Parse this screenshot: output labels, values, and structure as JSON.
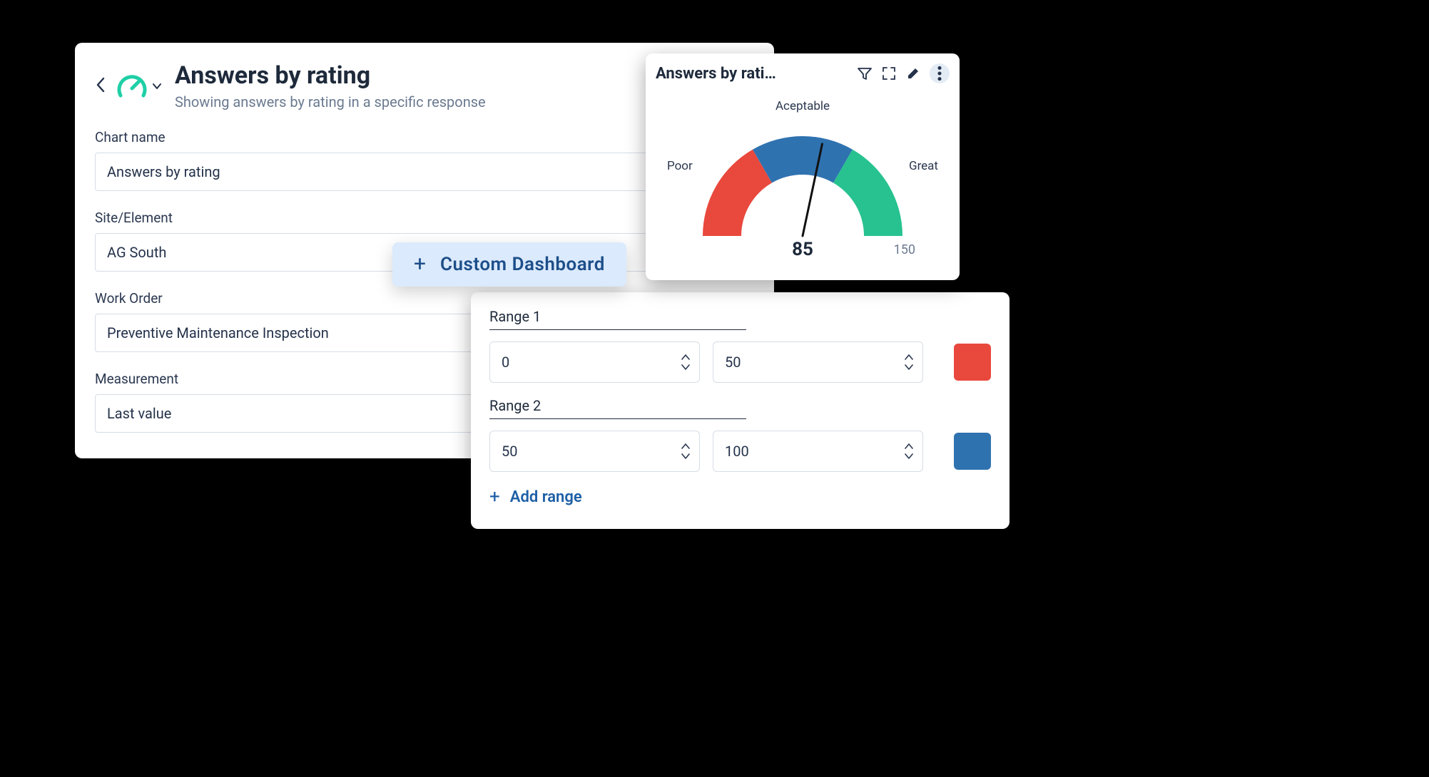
{
  "form": {
    "title": "Answers by rating",
    "subtitle": "Showing answers by rating in a specific response",
    "fields": {
      "chart_name": {
        "label": "Chart name",
        "value": "Answers by rating"
      },
      "site": {
        "label": "Site/Element",
        "value": "AG South"
      },
      "work_order": {
        "label": "Work Order",
        "value": "Preventive Maintenance Inspection"
      },
      "measurement": {
        "label": "Measurement",
        "value": "Last value"
      }
    }
  },
  "pill": {
    "label": "Custom Dashboard"
  },
  "gauge_card": {
    "title": "Answers by rati…",
    "labels": {
      "poor": "Poor",
      "mid": "Aceptable",
      "great": "Great"
    },
    "value": "85",
    "max": "150"
  },
  "chart_data": {
    "type": "gauge",
    "title": "Answers by rating",
    "value": 85,
    "min": 0,
    "max": 150,
    "segments": [
      {
        "label": "Poor",
        "from": 0,
        "to": 50,
        "color": "#e9483d"
      },
      {
        "label": "Aceptable",
        "from": 50,
        "to": 100,
        "color": "#2f72b0"
      },
      {
        "label": "Great",
        "from": 100,
        "to": 150,
        "color": "#27c28f"
      }
    ]
  },
  "ranges": {
    "r1": {
      "title": "Range 1",
      "from": "0",
      "to": "50"
    },
    "r2": {
      "title": "Range 2",
      "from": "50",
      "to": "100"
    },
    "add_label": "Add range"
  }
}
